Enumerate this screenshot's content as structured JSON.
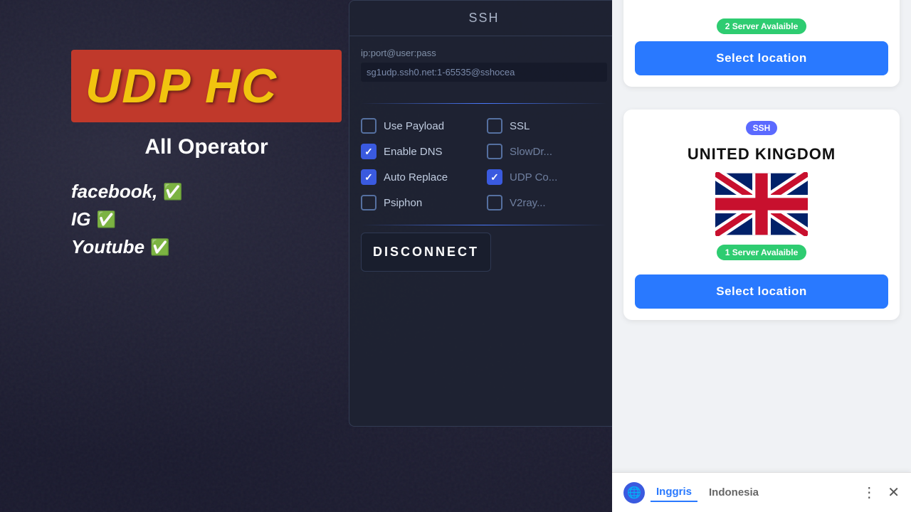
{
  "app": {
    "title": "UDP HC"
  },
  "left": {
    "logo": "UDP HC",
    "operator": "All Operator",
    "socials": [
      {
        "name": "facebook,",
        "checked": true
      },
      {
        "name": "IG",
        "checked": true
      },
      {
        "name": "Youtube",
        "checked": true
      }
    ]
  },
  "ssh_panel": {
    "header": "SSH",
    "input_label": "ip:port@user:pass",
    "input_value": "sg1udp.ssh0.net:1-65535@sshocea",
    "options": [
      {
        "label": "Use Payload",
        "checked": false
      },
      {
        "label": "SSL",
        "checked": false
      },
      {
        "label": "Enable DNS",
        "checked": true
      },
      {
        "label": "SlowDr...",
        "checked": false
      },
      {
        "label": "Auto Replace",
        "checked": true
      },
      {
        "label": "UDP Co...",
        "checked": true
      },
      {
        "label": "Psiphon",
        "checked": false
      },
      {
        "label": "V2ray...",
        "checked": false
      }
    ],
    "disconnect_label": "DISCONNECT"
  },
  "right": {
    "card1": {
      "server_badge": "2 Server Avalaible",
      "select_btn": "Select location"
    },
    "card2": {
      "ssh_badge": "SSH",
      "country": "UNITED KINGDOM",
      "server_badge": "1 Server Avalaible",
      "select_btn": "Select location"
    }
  },
  "translation_bar": {
    "lang_active": "Inggris",
    "lang_inactive": "Indonesia"
  }
}
